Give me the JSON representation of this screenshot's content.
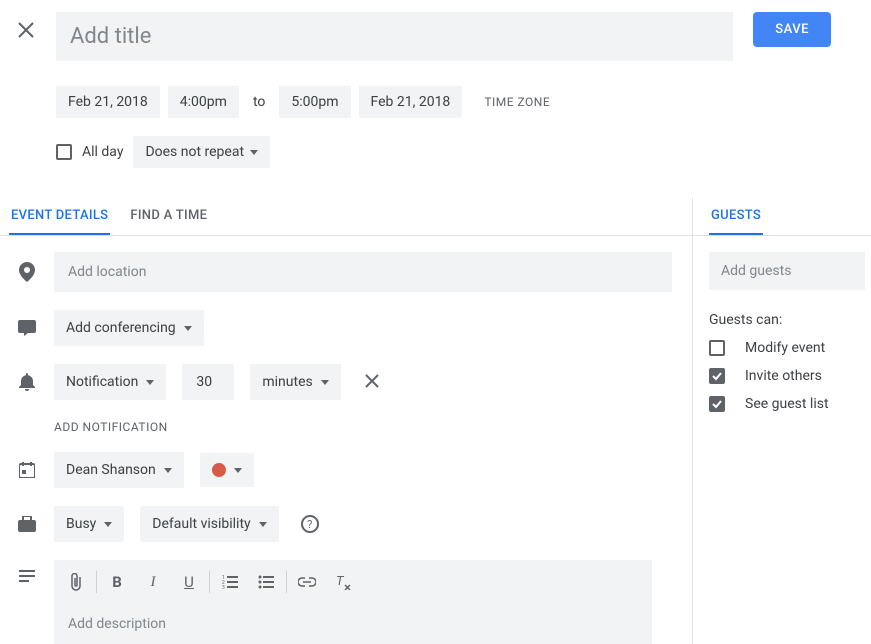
{
  "header": {
    "title_placeholder": "Add title",
    "save_label": "SAVE"
  },
  "time": {
    "start_date": "Feb 21, 2018",
    "start_time": "4:00pm",
    "to": "to",
    "end_time": "5:00pm",
    "end_date": "Feb 21, 2018",
    "timezone_label": "TIME ZONE"
  },
  "allday": {
    "label": "All day",
    "repeat": "Does not repeat"
  },
  "tabs": {
    "details": "EVENT DETAILS",
    "find": "FIND A TIME"
  },
  "location_placeholder": "Add location",
  "conferencing": "Add conferencing",
  "notification": {
    "type": "Notification",
    "value": "30",
    "unit": "minutes",
    "add": "ADD NOTIFICATION"
  },
  "calendar": {
    "owner": "Dean Shanson"
  },
  "availability": {
    "busy": "Busy",
    "visibility": "Default visibility"
  },
  "description_placeholder": "Add description",
  "guests": {
    "tab": "GUESTS",
    "placeholder": "Add guests",
    "can_label": "Guests can:",
    "modify": "Modify event",
    "invite": "Invite others",
    "see": "See guest list"
  }
}
